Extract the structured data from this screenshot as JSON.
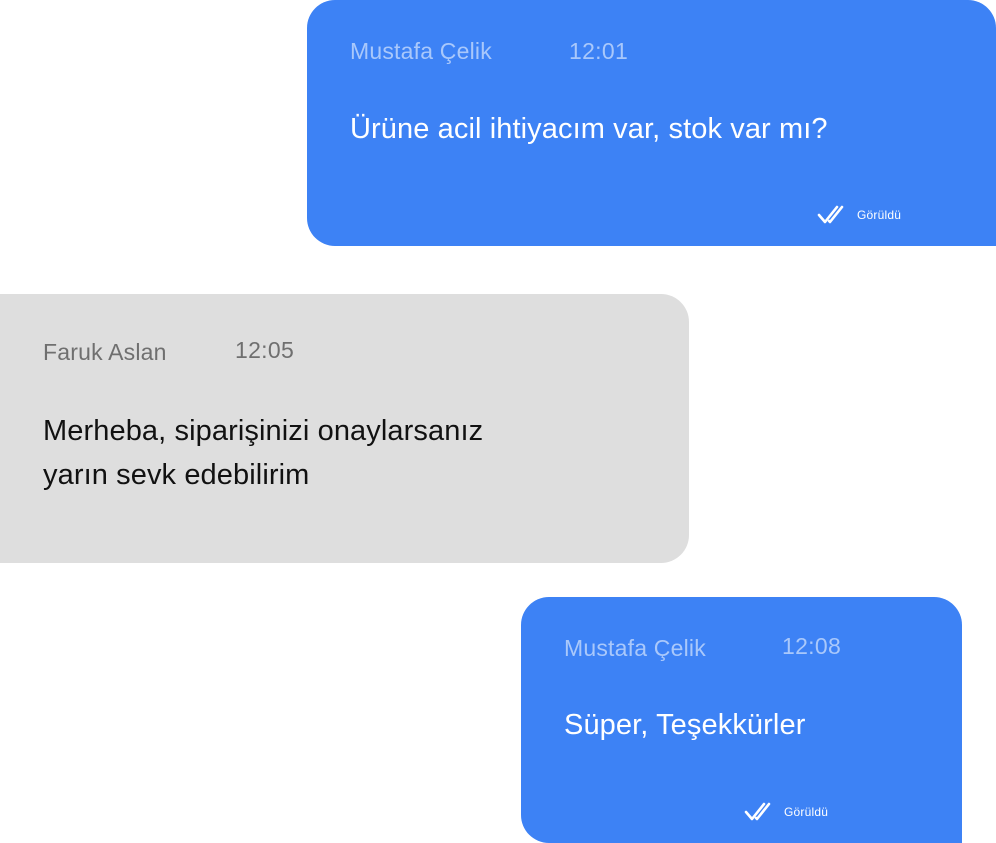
{
  "messages": [
    {
      "direction": "outgoing",
      "sender": "Mustafa Çelik",
      "time": "12:01",
      "text": "Ürüne acil ihtiyacım var, stok var mı?",
      "status": "Görüldü",
      "status_icon": "double-check-icon"
    },
    {
      "direction": "incoming",
      "sender": "Faruk Aslan",
      "time": "12:05",
      "text_lines": [
        "Merheba, siparişinizi onaylarsanız",
        "yarın sevk edebilirim"
      ]
    },
    {
      "direction": "outgoing",
      "sender": "Mustafa Çelik",
      "time": "12:08",
      "text": "Süper, Teşekkürler",
      "status": "Görüldü",
      "status_icon": "double-check-icon"
    }
  ],
  "colors": {
    "outgoing_bubble": "#3d82f5",
    "incoming_bubble": "#dedede",
    "outgoing_meta": "#a9c8fb",
    "incoming_meta": "#6f6f6f"
  }
}
